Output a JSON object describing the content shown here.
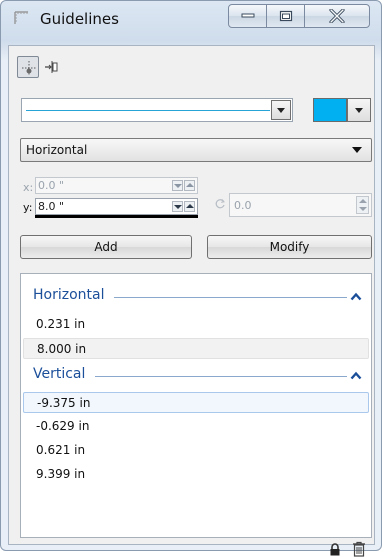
{
  "window": {
    "title": "Guidelines"
  },
  "toolbar": {
    "active_tool_icon": "guideline-tool-icon",
    "second_tool_icon": "snap-to-guide-icon"
  },
  "line": {
    "color": "#27a3d6"
  },
  "color": {
    "value": "#00b0f0"
  },
  "orientation": {
    "selected": "Horizontal"
  },
  "coords": {
    "x_label": "x:",
    "x_value": "0.0 \"",
    "y_label": "y:",
    "y_value": "8.0 \"",
    "angle_value": "0.0"
  },
  "buttons": {
    "add_label": "Add",
    "modify_label": "Modify"
  },
  "guides": {
    "horizontal_title": "Horizontal",
    "horizontal": [
      "0.231 in",
      "8.000 in"
    ],
    "vertical_title": "Vertical",
    "vertical": [
      "-9.375 in",
      "-0.629 in",
      "0.621 in",
      "9.399 in"
    ]
  },
  "colors": {
    "accent_text": "#1c4f9a",
    "selection_border": "#a9c8ec"
  }
}
